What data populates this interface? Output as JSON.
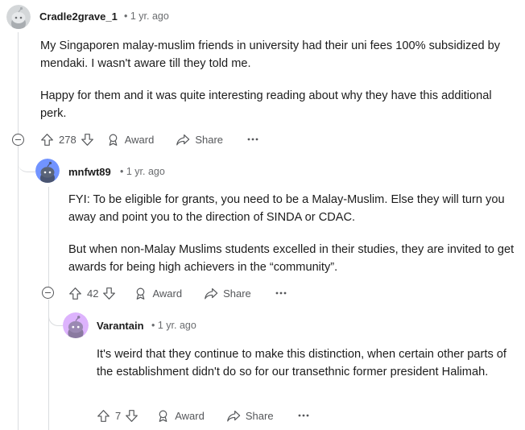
{
  "comments": [
    {
      "username": "Cradle2grave_1",
      "time": "1 yr. ago",
      "paragraphs": [
        "My Singaporen malay-muslim friends in university had their uni fees 100% subsidized by mendaki. I wasn't aware till they told me.",
        "Happy for them and it was quite interesting reading about why they have this additional perk."
      ],
      "votes": "278",
      "award_label": "Award",
      "share_label": "Share",
      "avatar_color": "#d4d7d9"
    },
    {
      "username": "mnfwt89",
      "time": "1 yr. ago",
      "paragraphs": [
        "FYI: To be eligible for grants, you need to be a Malay-Muslim. Else they will turn you away and point you to the direction of SINDA or CDAC.",
        "But when non-Malay Muslims students excelled in their studies, they are invited to get awards for being high achievers in the “community”."
      ],
      "votes": "42",
      "award_label": "Award",
      "share_label": "Share",
      "avatar_color": "#7193ff"
    },
    {
      "username": "Varantain",
      "time": "1 yr. ago",
      "paragraphs": [
        "It's weird that they continue to make this distinction, when certain other parts of the establishment didn't do so for our transethnic former president Halimah."
      ],
      "votes": "7",
      "award_label": "Award",
      "share_label": "Share",
      "avatar_color": "#ddb3fd"
    }
  ],
  "separator": "•"
}
